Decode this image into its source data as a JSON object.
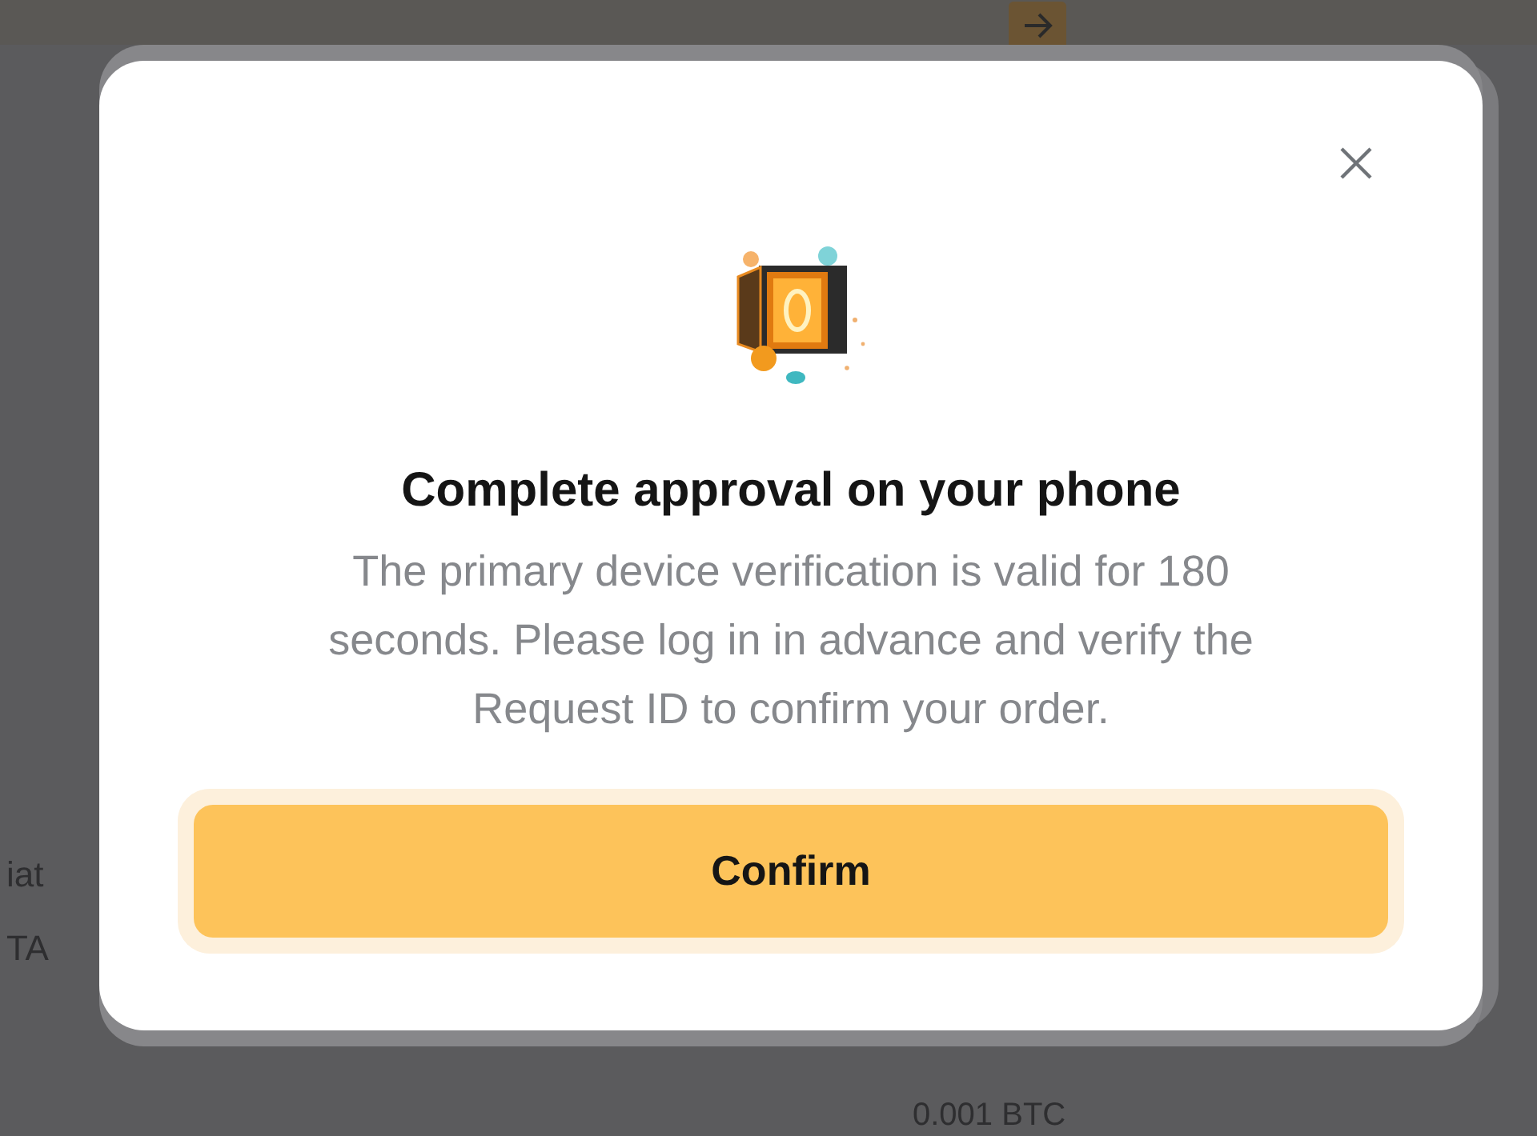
{
  "background": {
    "labels": [
      "iat",
      "TA"
    ],
    "bottom_text": "0.001 BTC"
  },
  "dialog": {
    "title": "Complete approval on your phone",
    "message": "The primary device verification is valid for 180 seconds. Please log in in advance and verify the Request ID to confirm your order.",
    "confirm_button": "Confirm"
  }
}
